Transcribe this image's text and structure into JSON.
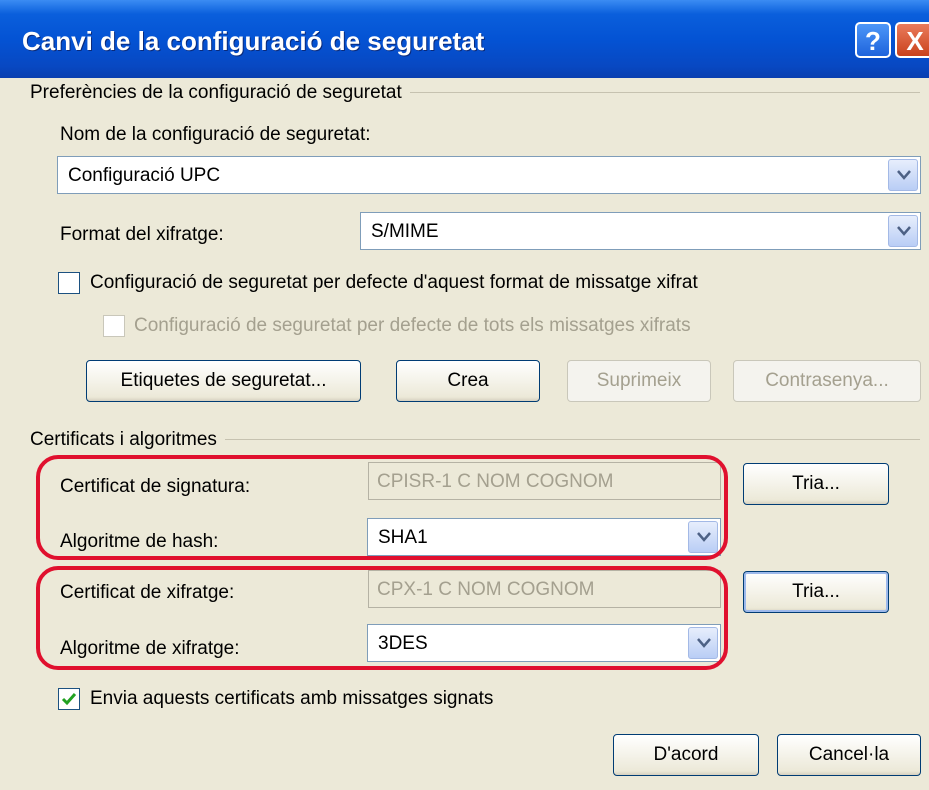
{
  "window": {
    "title": "Canvi de la configuració de seguretat",
    "help_label": "?",
    "close_label": "X"
  },
  "prefs": {
    "group_label": "Preferències de la configuració de seguretat",
    "name_label": "Nom de la configuració de seguretat:",
    "name_value": "Configuració UPC",
    "format_label": "Format del xifratge:",
    "format_value": "S/MIME",
    "default_format_label": "Configuració de seguretat per defecte d'aquest format de missatge xifrat",
    "default_all_label": "Configuració de seguretat per defecte de tots els missatges xifrats",
    "buttons": {
      "labels": "Etiquetes de seguretat...",
      "create": "Crea",
      "delete": "Suprimeix",
      "password": "Contrasenya..."
    }
  },
  "certs": {
    "group_label": "Certificats i algoritmes",
    "signing_cert_label": "Certificat de signatura:",
    "signing_cert_value": "CPISR-1 C NOM COGNOM",
    "hash_label": "Algoritme de hash:",
    "hash_value": "SHA1",
    "enc_cert_label": "Certificat de xifratge:",
    "enc_cert_value": "CPX-1 C NOM COGNOM",
    "enc_alg_label": "Algoritme de xifratge:",
    "enc_alg_value": "3DES",
    "choose_label": "Tria...",
    "send_certs_label": "Envia aquests certificats amb missatges signats",
    "send_certs_checked": true
  },
  "footer": {
    "ok": "D'acord",
    "cancel": "Cancel·la"
  },
  "colors": {
    "titlebar": "#0453d4",
    "highlight": "#e0102e",
    "dialog_bg": "#ece9d8",
    "check": "#21a121"
  }
}
